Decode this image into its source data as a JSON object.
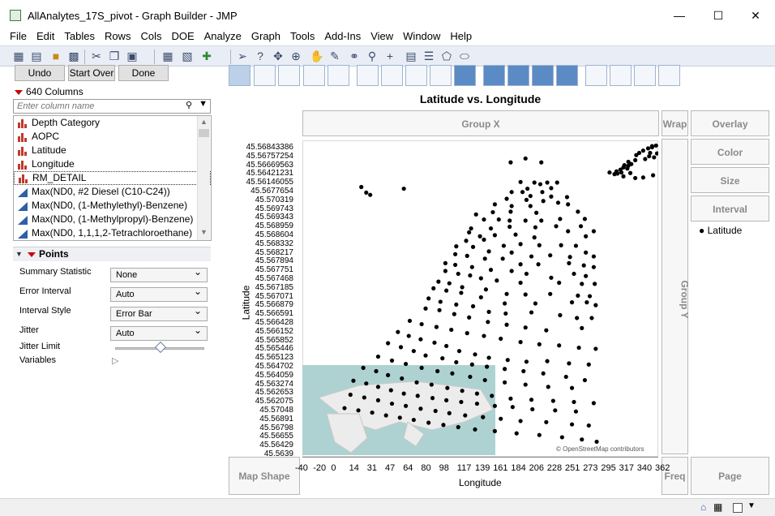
{
  "window": {
    "title": "AllAnalytes_17S_pivot - Graph Builder - JMP"
  },
  "menu": [
    "File",
    "Edit",
    "Tables",
    "Rows",
    "Cols",
    "DOE",
    "Analyze",
    "Graph",
    "Tools",
    "Add-Ins",
    "View",
    "Window",
    "Help"
  ],
  "buttons": {
    "undo": "Undo",
    "start_over": "Start Over",
    "done": "Done"
  },
  "columns": {
    "count_label": "640 Columns",
    "search_placeholder": "Enter column name",
    "items": [
      {
        "label": "Depth Category",
        "type": "nominal"
      },
      {
        "label": "AOPC",
        "type": "nominal"
      },
      {
        "label": "Latitude",
        "type": "nominal"
      },
      {
        "label": "Longitude",
        "type": "nominal"
      },
      {
        "label": "RM_DETAIL",
        "type": "nominal"
      },
      {
        "label": "Max(ND0, #2 Diesel   (C10-C24))",
        "type": "continuous"
      },
      {
        "label": "Max(ND0, (1-Methylethyl)-Benzene)",
        "type": "continuous"
      },
      {
        "label": "Max(ND0, (1-Methylpropyl)-Benzene)",
        "type": "continuous"
      },
      {
        "label": "Max(ND0, 1,1,1,2-Tetrachloroethane)",
        "type": "continuous"
      }
    ]
  },
  "points_panel": {
    "header": "Points",
    "rows": [
      {
        "label": "Summary Statistic",
        "value": "None"
      },
      {
        "label": "Error Interval",
        "value": "Auto"
      },
      {
        "label": "Interval Style",
        "value": "Error Bar"
      },
      {
        "label": "Jitter",
        "value": "Auto"
      }
    ],
    "jitter_limit_label": "Jitter Limit",
    "jitter_limit_value": 0.5,
    "variables_label": "Variables"
  },
  "zones": {
    "group_x": "Group X",
    "wrap": "Wrap",
    "overlay": "Overlay",
    "color": "Color",
    "size": "Size",
    "interval": "Interval",
    "group_y": "Group Y",
    "map_shape": "Map Shape",
    "freq": "Freq",
    "page": "Page"
  },
  "legend": {
    "item": "Latitude"
  },
  "map_credit": "© OpenStreetMap contributors",
  "chart_data": {
    "type": "scatter",
    "title": "Latitude vs. Longitude",
    "xlabel": "Longitude",
    "ylabel": "Latitude",
    "x_ticks": [
      "-40",
      "-20",
      "0",
      "14",
      "31",
      "47",
      "64",
      "80",
      "98",
      "117",
      "139",
      "161",
      "184",
      "206",
      "228",
      "251",
      "273",
      "295",
      "317",
      "340",
      "362"
    ],
    "y_ticks": [
      "45.56843386",
      "45.56757254",
      "45.56669563",
      "45.56421231",
      "45.56146055",
      "45.5677654",
      "45.570319",
      "45.569743",
      "45.569343",
      "45.568959",
      "45.568604",
      "45.568332",
      "45.568217",
      "45.567894",
      "45.567751",
      "45.567468",
      "45.567185",
      "45.567071",
      "45.566879",
      "45.566591",
      "45.566428",
      "45.566152",
      "45.565852",
      "45.565446",
      "45.565123",
      "45.564702",
      "45.564059",
      "45.563274",
      "45.562653",
      "45.562075",
      "45.57048",
      "45.56891",
      "45.56798",
      "45.56655",
      "45.56429",
      "45.5639"
    ],
    "points": [
      [
        329,
        6
      ],
      [
        333,
        5
      ],
      [
        329,
        8
      ],
      [
        325,
        10
      ],
      [
        337,
        12
      ],
      [
        320,
        14
      ],
      [
        316,
        18
      ],
      [
        327,
        18
      ],
      [
        334,
        19
      ],
      [
        313,
        22
      ],
      [
        326,
        24
      ],
      [
        331,
        26
      ],
      [
        322,
        29
      ],
      [
        312,
        31
      ],
      [
        305,
        34
      ],
      [
        308,
        38
      ],
      [
        301,
        40
      ],
      [
        305,
        41
      ],
      [
        300,
        44
      ],
      [
        304,
        46
      ],
      [
        297,
        48
      ],
      [
        293,
        51
      ],
      [
        294,
        55
      ],
      [
        291,
        56
      ],
      [
        298,
        53
      ],
      [
        307,
        54
      ],
      [
        330,
        58
      ],
      [
        339,
        55
      ],
      [
        320,
        62
      ],
      [
        312,
        63
      ],
      [
        300,
        60
      ],
      [
        286,
        53
      ],
      [
        201,
        28
      ],
      [
        186,
        35
      ],
      [
        217,
        35
      ],
      [
        78,
        82
      ],
      [
        35,
        79
      ],
      [
        40,
        89
      ],
      [
        44,
        93
      ],
      [
        196,
        70
      ],
      [
        210,
        71
      ],
      [
        223,
        71
      ],
      [
        233,
        71
      ],
      [
        216,
        74
      ],
      [
        227,
        81
      ],
      [
        203,
        82
      ],
      [
        187,
        88
      ],
      [
        198,
        88
      ],
      [
        218,
        88
      ],
      [
        206,
        95
      ],
      [
        227,
        96
      ],
      [
        243,
        97
      ],
      [
        182,
        100
      ],
      [
        202,
        102
      ],
      [
        219,
        104
      ],
      [
        234,
        107
      ],
      [
        244,
        110
      ],
      [
        170,
        110
      ],
      [
        187,
        113
      ],
      [
        206,
        113
      ],
      [
        168,
        124
      ],
      [
        186,
        123
      ],
      [
        212,
        125
      ],
      [
        254,
        123
      ],
      [
        236,
        136
      ],
      [
        261,
        136
      ],
      [
        151,
        128
      ],
      [
        159,
        137
      ],
      [
        174,
        137
      ],
      [
        185,
        139
      ],
      [
        201,
        139
      ],
      [
        217,
        139
      ],
      [
        232,
        149
      ],
      [
        257,
        149
      ],
      [
        146,
        153
      ],
      [
        166,
        153
      ],
      [
        185,
        150
      ],
      [
        211,
        151
      ],
      [
        244,
        158
      ],
      [
        270,
        158
      ],
      [
        144,
        160
      ],
      [
        155,
        167
      ],
      [
        170,
        165
      ],
      [
        191,
        164
      ],
      [
        210,
        169
      ],
      [
        262,
        167
      ],
      [
        141,
        175
      ],
      [
        159,
        173
      ],
      [
        179,
        184
      ],
      [
        196,
        181
      ],
      [
        215,
        183
      ],
      [
        237,
        183
      ],
      [
        252,
        184
      ],
      [
        131,
        185
      ],
      [
        148,
        186
      ],
      [
        164,
        194
      ],
      [
        187,
        196
      ],
      [
        207,
        203
      ],
      [
        226,
        201
      ],
      [
        246,
        204
      ],
      [
        262,
        196
      ],
      [
        270,
        203
      ],
      [
        130,
        199
      ],
      [
        142,
        202
      ],
      [
        160,
        207
      ],
      [
        178,
        207
      ],
      [
        196,
        217
      ],
      [
        214,
        217
      ],
      [
        245,
        215
      ],
      [
        260,
        219
      ],
      [
        270,
        222
      ],
      [
        120,
        215
      ],
      [
        130,
        218
      ],
      [
        147,
        222
      ],
      [
        166,
        227
      ],
      [
        187,
        229
      ],
      [
        202,
        234
      ],
      [
        227,
        241
      ],
      [
        250,
        234
      ],
      [
        262,
        238
      ],
      [
        120,
        229
      ],
      [
        133,
        234
      ],
      [
        145,
        237
      ],
      [
        156,
        242
      ],
      [
        172,
        246
      ],
      [
        196,
        250
      ],
      [
        235,
        250
      ],
      [
        258,
        252
      ],
      [
        271,
        252
      ],
      [
        113,
        248
      ],
      [
        124,
        251
      ],
      [
        137,
        258
      ],
      [
        161,
        262
      ],
      [
        182,
        270
      ],
      [
        201,
        271
      ],
      [
        226,
        270
      ],
      [
        254,
        273
      ],
      [
        266,
        274
      ],
      [
        108,
        260
      ],
      [
        121,
        264
      ],
      [
        136,
        268
      ],
      [
        156,
        276
      ],
      [
        180,
        287
      ],
      [
        211,
        287
      ],
      [
        248,
        285
      ],
      [
        263,
        285
      ],
      [
        272,
        290
      ],
      [
        103,
        278
      ],
      [
        115,
        284
      ],
      [
        131,
        289
      ],
      [
        148,
        292
      ],
      [
        164,
        302
      ],
      [
        181,
        305
      ],
      [
        207,
        303
      ],
      [
        236,
        308
      ],
      [
        253,
        313
      ],
      [
        268,
        313
      ],
      [
        100,
        296
      ],
      [
        114,
        299
      ],
      [
        129,
        306
      ],
      [
        144,
        312
      ],
      [
        163,
        320
      ],
      [
        182,
        325
      ],
      [
        201,
        330
      ],
      [
        222,
        335
      ],
      [
        258,
        331
      ],
      [
        84,
        318
      ],
      [
        96,
        324
      ],
      [
        111,
        329
      ],
      [
        126,
        334
      ],
      [
        142,
        340
      ],
      [
        159,
        345
      ],
      [
        176,
        350
      ],
      [
        196,
        356
      ],
      [
        215,
        360
      ],
      [
        235,
        362
      ],
      [
        255,
        366
      ],
      [
        272,
        368
      ],
      [
        72,
        338
      ],
      [
        83,
        345
      ],
      [
        95,
        351
      ],
      [
        109,
        357
      ],
      [
        121,
        363
      ],
      [
        134,
        372
      ],
      [
        150,
        378
      ],
      [
        164,
        384
      ],
      [
        183,
        388
      ],
      [
        202,
        391
      ],
      [
        223,
        390
      ],
      [
        245,
        394
      ],
      [
        265,
        396
      ],
      [
        62,
        358
      ],
      [
        75,
        365
      ],
      [
        88,
        372
      ],
      [
        100,
        380
      ],
      [
        117,
        385
      ],
      [
        131,
        392
      ],
      [
        147,
        396
      ],
      [
        162,
        400
      ],
      [
        180,
        404
      ],
      [
        199,
        408
      ],
      [
        219,
        412
      ],
      [
        242,
        418
      ],
      [
        261,
        424
      ],
      [
        52,
        382
      ],
      [
        66,
        389
      ],
      [
        80,
        395
      ],
      [
        96,
        402
      ],
      [
        112,
        408
      ],
      [
        127,
        412
      ],
      [
        145,
        418
      ],
      [
        160,
        424
      ],
      [
        180,
        428
      ],
      [
        201,
        432
      ],
      [
        224,
        436
      ],
      [
        248,
        438
      ],
      [
        37,
        402
      ],
      [
        50,
        408
      ],
      [
        62,
        415
      ],
      [
        76,
        421
      ],
      [
        91,
        428
      ],
      [
        106,
        432
      ],
      [
        122,
        438
      ],
      [
        137,
        443
      ],
      [
        152,
        448
      ],
      [
        167,
        452
      ],
      [
        186,
        457
      ],
      [
        207,
        459
      ],
      [
        229,
        461
      ],
      [
        250,
        463
      ],
      [
        270,
        465
      ],
      [
        27,
        425
      ],
      [
        40,
        430
      ],
      [
        52,
        436
      ],
      [
        65,
        442
      ],
      [
        78,
        448
      ],
      [
        92,
        452
      ],
      [
        107,
        456
      ],
      [
        121,
        460
      ],
      [
        136,
        463
      ],
      [
        152,
        466
      ],
      [
        170,
        470
      ],
      [
        188,
        472
      ],
      [
        208,
        476
      ],
      [
        231,
        478
      ],
      [
        252,
        480
      ],
      [
        24,
        450
      ],
      [
        38,
        455
      ],
      [
        52,
        460
      ],
      [
        66,
        466
      ],
      [
        80,
        470
      ],
      [
        95,
        475
      ],
      [
        110,
        479
      ],
      [
        124,
        483
      ],
      [
        140,
        487
      ],
      [
        158,
        490
      ],
      [
        176,
        493
      ],
      [
        196,
        497
      ],
      [
        222,
        499
      ],
      [
        248,
        503
      ],
      [
        265,
        505
      ],
      [
        18,
        474
      ],
      [
        32,
        478
      ],
      [
        46,
        482
      ],
      [
        60,
        487
      ],
      [
        74,
        491
      ],
      [
        88,
        495
      ],
      [
        103,
        500
      ],
      [
        118,
        504
      ],
      [
        133,
        508
      ],
      [
        150,
        512
      ],
      [
        170,
        515
      ],
      [
        192,
        519
      ],
      [
        215,
        522
      ],
      [
        238,
        526
      ],
      [
        258,
        530
      ],
      [
        273,
        534
      ]
    ]
  }
}
